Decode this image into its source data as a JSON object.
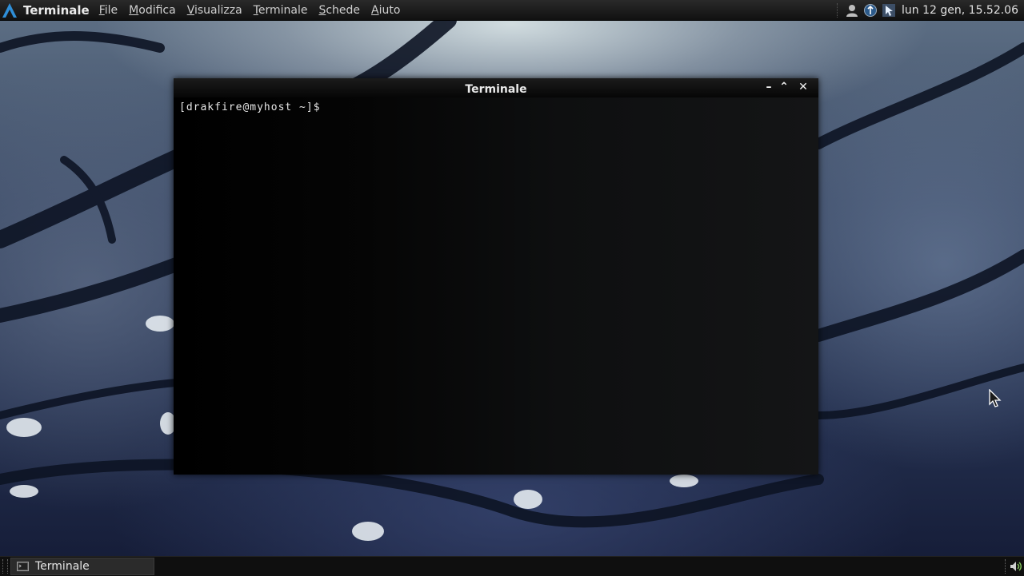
{
  "top_panel": {
    "app_name": "Terminale",
    "menus": [
      {
        "accel": "F",
        "rest": "ile"
      },
      {
        "accel": "M",
        "rest": "odifica"
      },
      {
        "accel": "V",
        "rest": "isualizza"
      },
      {
        "accel": "T",
        "rest": "erminale"
      },
      {
        "accel": "S",
        "rest": "chede"
      },
      {
        "accel": "A",
        "rest": "iuto"
      }
    ],
    "tray_icons": [
      "user-icon",
      "network-icon",
      "pointer-tool-icon"
    ],
    "clock": "lun 12 gen, 15.52.06"
  },
  "window": {
    "title": "Terminale",
    "minimize_glyph": "–",
    "maximize_glyph": "⌃",
    "close_glyph": "✕",
    "prompt": "[drakfire@myhost ~]$ "
  },
  "bottom_panel": {
    "tasks": [
      {
        "label": "Terminale",
        "icon": "terminal-icon"
      }
    ],
    "tray_icons": [
      "volume-icon"
    ]
  },
  "colors": {
    "panel_bg": "#111111",
    "terminal_bg": "#000000",
    "text": "#e6e6e6",
    "accent_logo": "#2f8fd8"
  }
}
